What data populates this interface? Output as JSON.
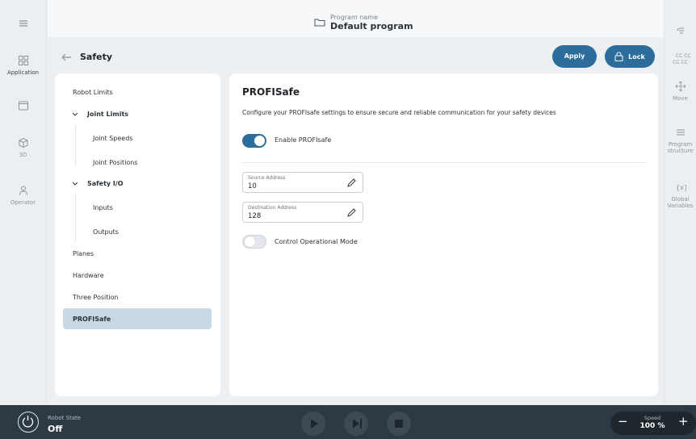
{
  "topbar": {
    "program_label": "Program name",
    "program_value": "Default program"
  },
  "left_rail": [
    {
      "label": "",
      "icon": "hamburger-icon"
    },
    {
      "label": "Application",
      "icon": "grid-icon"
    },
    {
      "label": "",
      "icon": "window-icon"
    },
    {
      "label": "3D",
      "icon": "cube-icon"
    },
    {
      "label": "Operator",
      "icon": "person-icon"
    }
  ],
  "right_rail": [
    {
      "label": "",
      "icon": "hand-icon"
    },
    {
      "label": "CC CC\nCC CC",
      "icon": "cc-icon"
    },
    {
      "label": "Move",
      "icon": "move-icon"
    },
    {
      "label": "Program structure",
      "icon": "list-icon"
    },
    {
      "label": "Global Variables",
      "icon": "variables-icon"
    }
  ],
  "page": {
    "title": "Safety",
    "apply": "Apply",
    "lock": "Lock"
  },
  "nav": {
    "robot_limits": "Robot Limits",
    "joint_limits": "Joint Limits",
    "joint_speeds": "Joint Speeds",
    "joint_positions": "Joint Positions",
    "safety_io": "Safety I/O",
    "inputs": "Inputs",
    "outputs": "Outputs",
    "planes": "Planes",
    "hardware": "Hardware",
    "three_position": "Three Position",
    "profisafe": "PROFISafe"
  },
  "content": {
    "title": "PROFISafe",
    "description": "Configure your PROFIsafe settings to ensure secure and reliable communication for your safety devices",
    "enable_label": "Enable PROFIsafe",
    "enable_on": true,
    "source_label": "Source Address",
    "source_value": "10",
    "dest_label": "Destination Address",
    "dest_value": "128",
    "control_label": "Control Operational Mode",
    "control_on": false
  },
  "bottombar": {
    "robot_state_label": "Robot State",
    "robot_state_value": "Off",
    "speed_label": "Speed",
    "speed_value": "100 %"
  }
}
